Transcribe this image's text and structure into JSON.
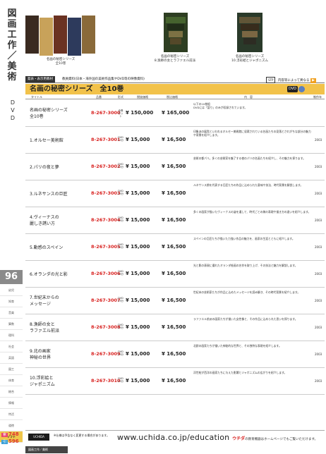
{
  "sidebar": {
    "title_chars": [
      "図",
      "画",
      "工",
      "作",
      "／",
      "美",
      "術"
    ],
    "dvd_chars": [
      "D",
      "V",
      "D"
    ],
    "page_number": "96",
    "categories": [
      "幼児",
      "知育",
      "音楽",
      "算数",
      "理科",
      "社会",
      "英語",
      "図工",
      "体育",
      "総合",
      "情報",
      "特活",
      "道徳"
    ],
    "active_category": "ソフト",
    "index": [
      {
        "label": "索",
        "number": "748"
      },
      {
        "label": "引",
        "number": "596"
      }
    ]
  },
  "photos": [
    {
      "caption": "名画の秘密シリーズ\n全10巻",
      "colors": [
        "#3a2a20",
        "#c8a25a",
        "#6a3222",
        "#2d3a5c",
        "#8a6a3a"
      ]
    },
    {
      "caption": "名画の秘密シリーズ\n8.漁師の女とラファエル前派",
      "colors": [
        "#2e3e22",
        "#4a6a30",
        "#1e2a16",
        "#8a7a4a",
        "#5a4a2a"
      ]
    },
    {
      "caption": "名画の秘密シリーズ\n10.浮彩絵とジャポニズム",
      "colors": [
        "#2a3a2a",
        "#6a5a3a",
        "#3a2a1a",
        "#8a7048",
        "#2e2a22"
      ]
    }
  ],
  "header": {
    "tag": "発表・表示用教材",
    "note": "教員資料(日本・海外国の美術作品集やDVD等の映像資料)",
    "ref_box": "STP",
    "ref_text": "内容等によって異なる"
  },
  "title": "名画の秘密シリーズ　全10巻",
  "dvd_badge": "DVD",
  "columns": [
    "タイトル",
    "品番",
    "形式",
    "税抜価格",
    "税込価格",
    "内　容",
    "制作年"
  ],
  "rows": [
    {
      "name": "名画の秘密シリーズ\n全10巻",
      "code": "8-267-3000",
      "format": "全巻セット",
      "price_ex": "¥ 150,000",
      "price_in": "¥ 165,000",
      "desc": "以下の10巻組\nDVDには「語り」のみが収録されています。",
      "year": ""
    },
    {
      "name": "1.オルセー美術館",
      "code": "8-267-3001",
      "format": "DVD\n23分",
      "price_ex": "¥ 15,000",
      "price_in": "¥ 16,500",
      "desc": "印象派の展覧といわれるオルセー美術館に収蔵されている名画たちの見落とされがちな部分の魅力や背景を紹介します。",
      "year": "2003"
    },
    {
      "name": "2.パリの夜と夢",
      "code": "8-267-3002",
      "format": "DVD\n23分",
      "price_ex": "¥ 15,000",
      "price_in": "¥ 16,500",
      "desc": "芸術の都パリ。多くの芸術家を魅了する夜のパリの名画たちを紹介し、その魅力を探ります。",
      "year": "2003"
    },
    {
      "name": "3.ルネサンスの巨匠",
      "code": "8-267-3003",
      "format": "DVD\n23分",
      "price_ex": "¥ 15,000",
      "price_in": "¥ 16,500",
      "desc": "ルネサンス期を代表する巨匠たちの作品に込められた意味や技法、時代背景を解説します。",
      "year": "2003"
    },
    {
      "name": "4.ヴィーナスの\n麗しき誘い方",
      "code": "8-267-3004",
      "format": "DVD\n23分",
      "price_ex": "¥ 15,000",
      "price_in": "¥ 16,500",
      "desc": "多くの画家が描いたヴィーナスの姿を通して、時代ごとの美の表現や描き方の違いを紹介します。",
      "year": "2003"
    },
    {
      "name": "5.動感のスペイン",
      "code": "8-267-3005",
      "format": "DVD\n23分",
      "price_ex": "¥ 15,000",
      "price_in": "¥ 16,500",
      "desc": "スペインの巨匠たちが描いた力強い作品の魅力を、画家の生涯とともに紹介します。",
      "year": "2003"
    },
    {
      "name": "6.オランダの光と影",
      "code": "8-267-3006",
      "format": "DVD\n23分",
      "price_ex": "¥ 15,000",
      "price_in": "¥ 16,500",
      "desc": "光と影の表現に優れたオランダ絵画の名作を取り上げ、その技法と魅力を解説します。",
      "year": "2003"
    },
    {
      "name": "7.世紀末からの\nメッセージ",
      "code": "8-267-3007",
      "format": "DVD\n23分",
      "price_ex": "¥ 15,000",
      "price_in": "¥ 16,500",
      "desc": "世紀末の芸術家たちが作品に込めたメッセージを読み解き、その時代背景を紹介します。",
      "year": "2003"
    },
    {
      "name": "8.漁師の女と\nラファエル前派",
      "code": "8-267-3008",
      "format": "DVD\n23分",
      "price_ex": "¥ 15,000",
      "price_in": "¥ 16,500",
      "desc": "ラファエル前派の画家たちが描いた女性像と、その作品に込められた思いを探ります。",
      "year": "2003"
    },
    {
      "name": "9.北の画家\n神秘の世界",
      "code": "8-267-3009",
      "format": "DVD\n23分",
      "price_ex": "¥ 15,000",
      "price_in": "¥ 16,500",
      "desc": "北欧の画家たちが描いた神秘的な世界と、その独特な表現を紹介します。",
      "year": "2003"
    },
    {
      "name": "10.浮彩絵と\nジャポニズム",
      "code": "8-267-3010",
      "format": "DVD\n23分",
      "price_ex": "¥ 15,000",
      "price_in": "¥ 16,500",
      "desc": "浮世絵が西洋の画家たちに与えた影響とジャポニズムの広がりを紹介します。",
      "year": "2003"
    }
  ],
  "footer": {
    "logo": "UCHIDA",
    "note": "※仕様は予告なく変更する場合があります。",
    "url": "www.uchida.co.jp/education",
    "brand_mark": "ウチダ",
    "brand_text": "の教育機器はホームページでもご覧いただけます。",
    "bottom_label": "図画工作／美術"
  },
  "colors": {
    "accent_yellow": "#f2c24a",
    "code_red": "#d8211f",
    "sidebar_gray": "#8a8a8a"
  }
}
